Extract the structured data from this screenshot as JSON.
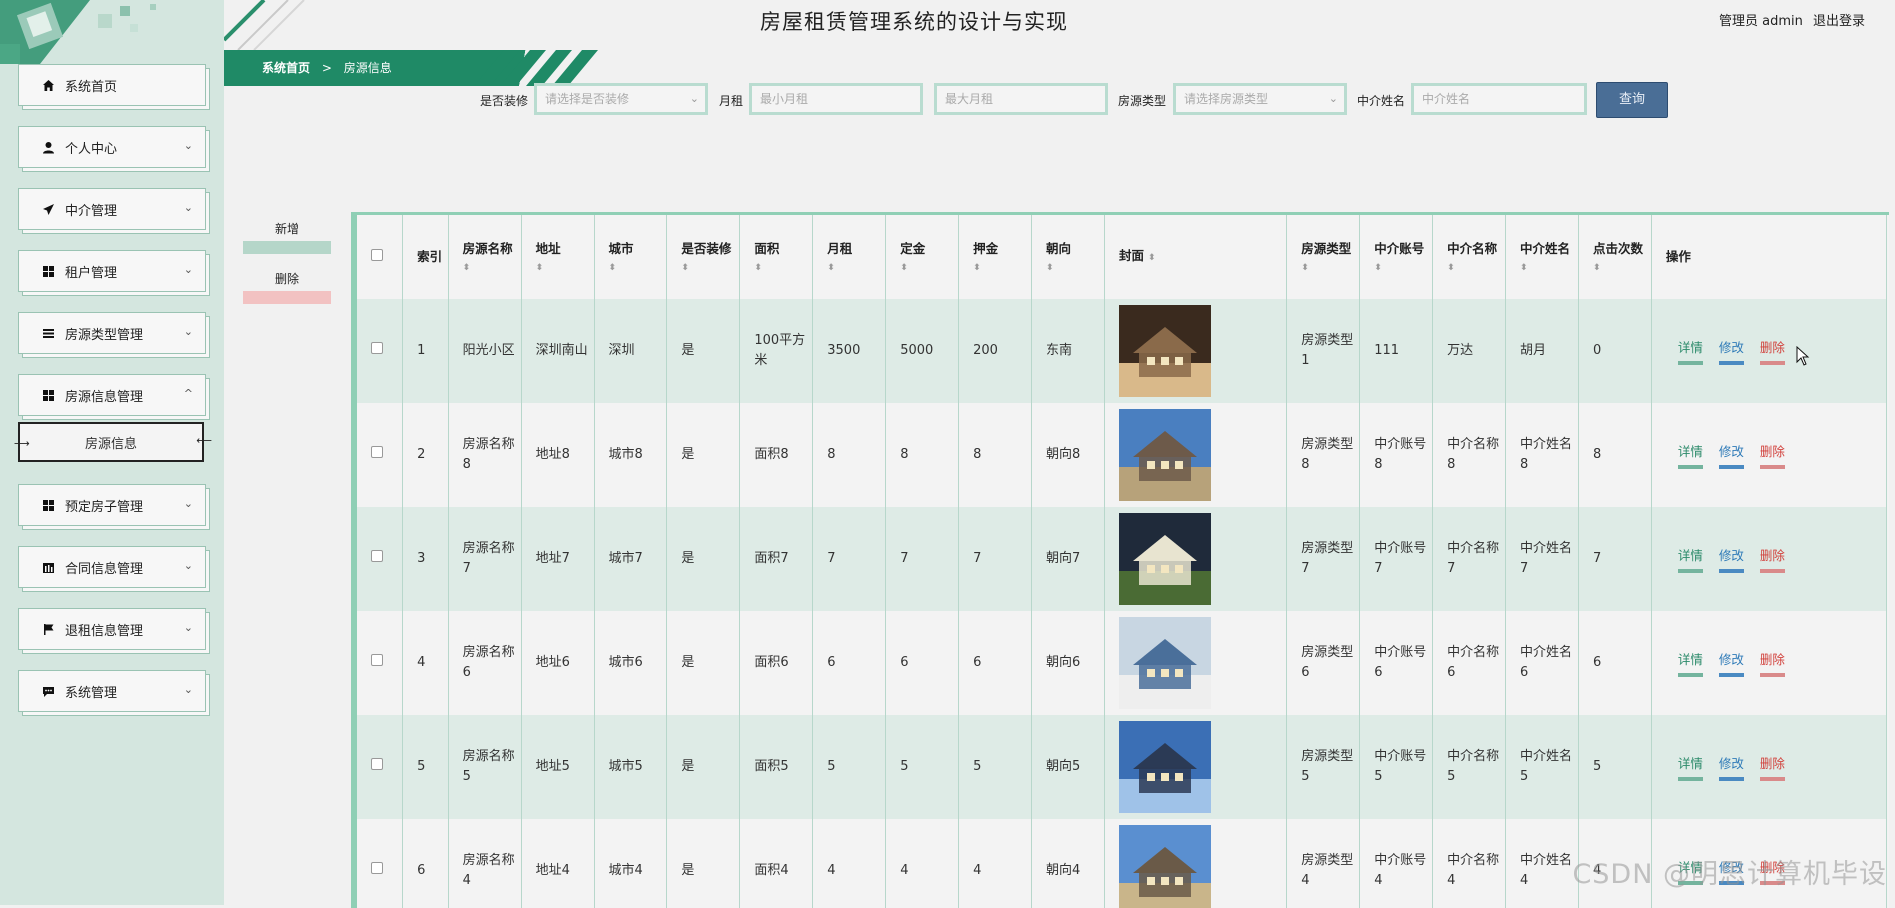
{
  "header": {
    "title": "房屋租赁管理系统的设计与实现",
    "user_label": "管理员 admin",
    "logout": "退出登录"
  },
  "breadcrumb": {
    "home": "系统首页",
    "separator": ">",
    "current": "房源信息"
  },
  "sidebar": {
    "items": [
      {
        "label": "系统首页",
        "icon": "home-icon",
        "chevron": ""
      },
      {
        "label": "个人中心",
        "icon": "user-icon",
        "chevron": "⌄"
      },
      {
        "label": "中介管理",
        "icon": "send-icon",
        "chevron": "⌄"
      },
      {
        "label": "租户管理",
        "icon": "grid-icon",
        "chevron": "⌄"
      },
      {
        "label": "房源类型管理",
        "icon": "list-icon",
        "chevron": "⌄"
      },
      {
        "label": "房源信息管理",
        "icon": "grid-icon",
        "chevron": "^"
      },
      {
        "label": "预定房子管理",
        "icon": "grid-icon",
        "chevron": "⌄"
      },
      {
        "label": "合同信息管理",
        "icon": "chart-icon",
        "chevron": "⌄"
      },
      {
        "label": "退租信息管理",
        "icon": "flag-icon",
        "chevron": "⌄"
      },
      {
        "label": "系统管理",
        "icon": "chat-icon",
        "chevron": "⌄"
      }
    ],
    "active_sub": "房源信息"
  },
  "search": {
    "decoration_label": "是否装修",
    "decoration_placeholder": "请选择是否装修",
    "rent_label": "月租",
    "rent_min_placeholder": "最小月租",
    "rent_max_placeholder": "最大月租",
    "type_label": "房源类型",
    "type_placeholder": "请选择房源类型",
    "agent_label": "中介姓名",
    "agent_placeholder": "中介姓名",
    "button": "查询"
  },
  "actions": {
    "add": "新增",
    "delete": "删除"
  },
  "table": {
    "headers": {
      "index": "索引",
      "name": "房源名称",
      "address": "地址",
      "city": "城市",
      "decorated": "是否装修",
      "area": "面积",
      "rent": "月租",
      "deposit": "定金",
      "guarantee": "押金",
      "orientation": "朝向",
      "cover": "封面",
      "type": "房源类型",
      "agent_account": "中介账号",
      "agent_name": "中介名称",
      "agent_person": "中介姓名",
      "clicks": "点击次数",
      "ops": "操作"
    },
    "ops": {
      "detail": "详情",
      "edit": "修改",
      "delete": "删除"
    },
    "rows": [
      {
        "index": "1",
        "name": "阳光小区",
        "address": "深圳南山",
        "city": "深圳",
        "decorated": "是",
        "area": "100平方米",
        "rent": "3500",
        "deposit": "5000",
        "guarantee": "200",
        "orientation": "东南",
        "type": "房源类型1",
        "agent_account": "111",
        "agent_name": "万达",
        "agent_person": "胡月",
        "clicks": "0"
      },
      {
        "index": "2",
        "name": "房源名称8",
        "address": "地址8",
        "city": "城市8",
        "decorated": "是",
        "area": "面积8",
        "rent": "8",
        "deposit": "8",
        "guarantee": "8",
        "orientation": "朝向8",
        "type": "房源类型8",
        "agent_account": "中介账号8",
        "agent_name": "中介名称8",
        "agent_person": "中介姓名8",
        "clicks": "8"
      },
      {
        "index": "3",
        "name": "房源名称7",
        "address": "地址7",
        "city": "城市7",
        "decorated": "是",
        "area": "面积7",
        "rent": "7",
        "deposit": "7",
        "guarantee": "7",
        "orientation": "朝向7",
        "type": "房源类型7",
        "agent_account": "中介账号7",
        "agent_name": "中介名称7",
        "agent_person": "中介姓名7",
        "clicks": "7"
      },
      {
        "index": "4",
        "name": "房源名称6",
        "address": "地址6",
        "city": "城市6",
        "decorated": "是",
        "area": "面积6",
        "rent": "6",
        "deposit": "6",
        "guarantee": "6",
        "orientation": "朝向6",
        "type": "房源类型6",
        "agent_account": "中介账号6",
        "agent_name": "中介名称6",
        "agent_person": "中介姓名6",
        "clicks": "6"
      },
      {
        "index": "5",
        "name": "房源名称5",
        "address": "地址5",
        "city": "城市5",
        "decorated": "是",
        "area": "面积5",
        "rent": "5",
        "deposit": "5",
        "guarantee": "5",
        "orientation": "朝向5",
        "type": "房源类型5",
        "agent_account": "中介账号5",
        "agent_name": "中介名称5",
        "agent_person": "中介姓名5",
        "clicks": "5"
      },
      {
        "index": "6",
        "name": "房源名称4",
        "address": "地址4",
        "city": "城市4",
        "decorated": "是",
        "area": "面积4",
        "rent": "4",
        "deposit": "4",
        "guarantee": "4",
        "orientation": "朝向4",
        "type": "房源类型4",
        "agent_account": "中介账号4",
        "agent_name": "中介名称4",
        "agent_person": "中介姓名4",
        "clicks": "4"
      }
    ]
  },
  "watermark": "CSDN @明思计算机毕设",
  "colors": {
    "accent": "#1f8a66",
    "sidebar_bg": "#d4e6df",
    "button": "#4a6e96",
    "row_alt": "#deebe6"
  }
}
